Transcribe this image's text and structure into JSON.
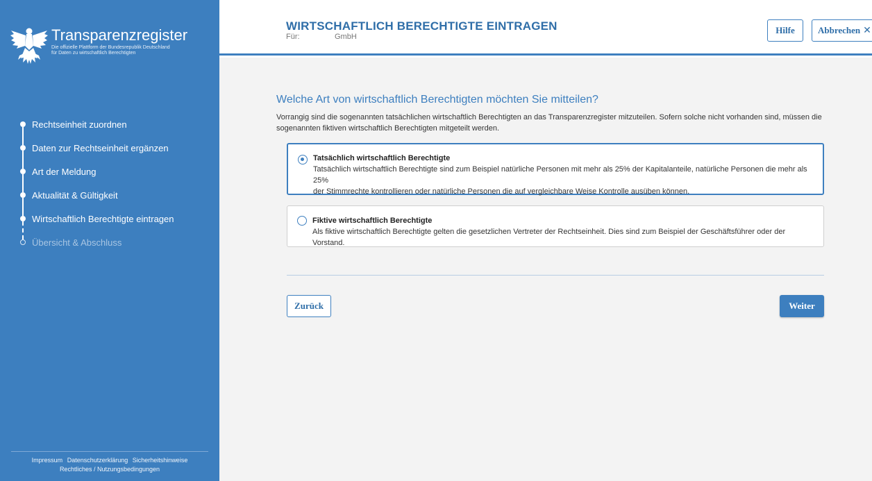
{
  "brand": {
    "title": "Transparenzregister",
    "subtitle_line1": "Die offizielle Plattform der Bundesrepublik Deutschland",
    "subtitle_line2": "für Daten zu wirtschaftlich Berechtigten",
    "logo_icon": "federal-eagle-icon"
  },
  "sidebar": {
    "steps": [
      {
        "label": "Rechtseinheit zuordnen",
        "state": "done"
      },
      {
        "label": "Daten zur Rechtseinheit ergänzen",
        "state": "done"
      },
      {
        "label": "Art der Meldung",
        "state": "done"
      },
      {
        "label": "Aktualität & Gültigkeit",
        "state": "done"
      },
      {
        "label": "Wirtschaftlich Berechtigte eintragen",
        "state": "current"
      },
      {
        "label": "Übersicht & Abschluss",
        "state": "pending"
      }
    ],
    "footer": {
      "impressum": "Impressum",
      "datenschutz": "Datenschutzerklärung",
      "sicherheit": "Sicherheitshinweise",
      "rechtliches": "Rechtliches / Nutzungsbedingungen"
    }
  },
  "header": {
    "title": "WIRTSCHAFTLICH BERECHTIGTE EINTRAGEN",
    "for_label": "Für:",
    "for_value": "GmbH",
    "help_label": "Hilfe",
    "cancel_label": "Abbrechen",
    "cancel_icon": "close-icon"
  },
  "main": {
    "question": "Welche Art von wirtschaftlich Berechtigten möchten Sie mitteilen?",
    "intro_line1": "Vorrangig sind die sogenannten tatsächlichen wirtschaftlich Berechtigten an das Transparenzregister mitzuteilen. Sofern solche nicht vorhanden sind, müssen die",
    "intro_line2": "sogenannten fiktiven wirtschaftlich Berechtigten mitgeteilt werden.",
    "options": [
      {
        "title": "Tatsächlich wirtschaftlich Berechtigte",
        "desc_line1": "Tatsächlich wirtschaftlich Berechtigte sind zum Beispiel natürliche Personen mit mehr als 25% der Kapitalanteile, natürliche Personen die mehr als 25%",
        "desc_line2": "der Stimmrechte kontrollieren oder natürliche Personen die auf vergleichbare Weise Kontrolle ausüben können.",
        "selected": true
      },
      {
        "title": "Fiktive wirtschaftlich Berechtigte",
        "desc_line1": "Als fiktive wirtschaftlich Berechtigte gelten die gesetzlichen Vertreter der Rechtseinheit. Dies sind zum Beispiel der Geschäftsführer oder der Vorstand.",
        "selected": false
      }
    ],
    "back_label": "Zurück",
    "next_label": "Weiter"
  },
  "colors": {
    "primary": "#3d7fbf",
    "background": "#f3f3f3",
    "heading": "#2f6ea8"
  }
}
